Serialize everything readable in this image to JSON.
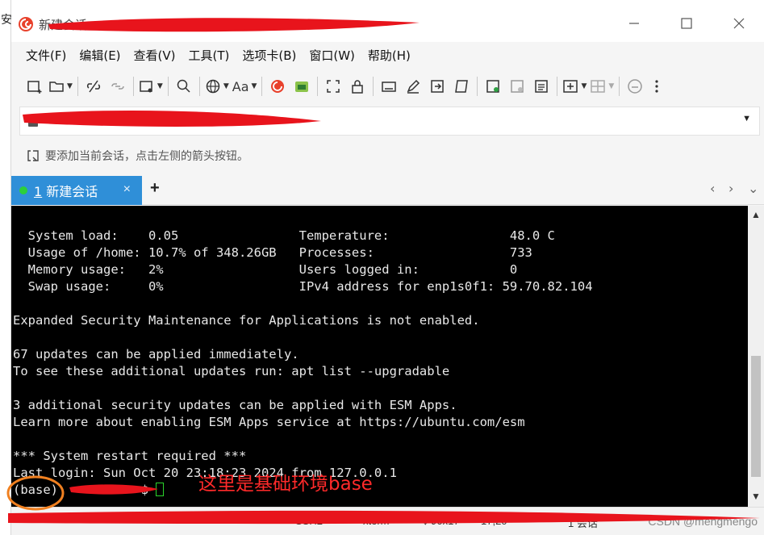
{
  "window": {
    "title": "新建会话",
    "left_sliver_char": "安"
  },
  "menu": [
    "文件(F)",
    "编辑(E)",
    "查看(V)",
    "工具(T)",
    "选项卡(B)",
    "窗口(W)",
    "帮助(H)"
  ],
  "toolbar": {
    "font_label": "Aa"
  },
  "hint": {
    "text": "要添加当前会话，点击左侧的箭头按钮。"
  },
  "tab": {
    "number": "1",
    "label": "新建会话",
    "close": "×",
    "plus": "+",
    "nav_left": "‹",
    "nav_right": "›",
    "nav_down": "⌄"
  },
  "terminal": {
    "lines": [
      "  System load:    0.05                Temperature:                48.0 C",
      "  Usage of /home: 10.7% of 348.26GB   Processes:                  733",
      "  Memory usage:   2%                  Users logged in:            0",
      "  Swap usage:     0%                  IPv4 address for enp1s0f1: 59.70.82.104",
      "",
      "Expanded Security Maintenance for Applications is not enabled.",
      "",
      "67 updates can be applied immediately.",
      "To see these additional updates run: apt list --upgradable",
      "",
      "3 additional security updates can be applied with ESM Apps.",
      "Learn more about enabling ESM Apps service at https://ubuntu.com/esm",
      "",
      "*** System restart required ***",
      "Last login: Sun Oct 20 23:18:23 2024 from 127.0.0.1"
    ],
    "prompt_env": "(base)",
    "prompt_suffix": " $ "
  },
  "annotation": {
    "text": "这里是基础环境base",
    "color": "#ff2a2a"
  },
  "status": {
    "ssh": "SSH2",
    "term": "xterm",
    "size": "↕ 90x17",
    "pos": "17,20",
    "sessions": "1 会话"
  },
  "watermark": "CSDN @mengmengo"
}
